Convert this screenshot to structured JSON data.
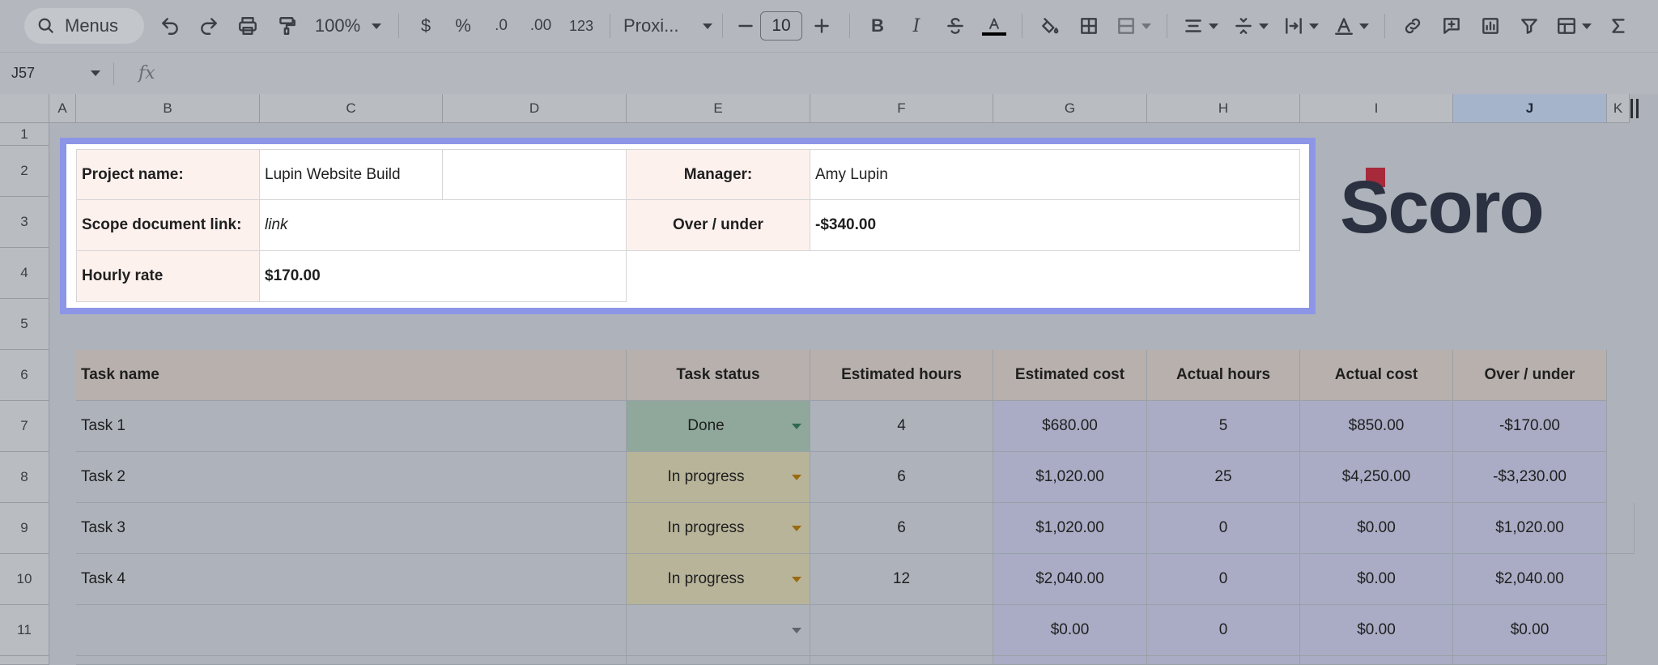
{
  "toolbar": {
    "menus_label": "Menus",
    "zoom": "100%",
    "currency": "$",
    "percent": "%",
    "dec_less": ".0",
    "dec_more": ".00",
    "number_format": "123",
    "font": "Proxi...",
    "font_size": "10",
    "bold": "B",
    "italic": "I"
  },
  "formula_bar": {
    "cell_ref": "J57",
    "fx": "fx"
  },
  "columns": [
    "A",
    "B",
    "C",
    "D",
    "E",
    "F",
    "G",
    "H",
    "I",
    "J",
    "K"
  ],
  "rows": [
    "1",
    "2",
    "3",
    "4",
    "5",
    "6",
    "7",
    "8",
    "9",
    "10",
    "11"
  ],
  "summary": {
    "project_label": "Project name:",
    "project_value": "Lupin Website Build",
    "manager_label": "Manager:",
    "manager_value": "Amy Lupin",
    "scope_label": "Scope document link:",
    "scope_value": "link",
    "over_label": "Over / under",
    "over_value": "-$340.00",
    "rate_label": "Hourly rate",
    "rate_value": "$170.00"
  },
  "table": {
    "headers": [
      "Task name",
      "Task status",
      "Estimated hours",
      "Estimated cost",
      "Actual hours",
      "Actual cost",
      "Over / under"
    ],
    "rows": [
      {
        "name": "Task 1",
        "status": "Done",
        "est_hours": "4",
        "est_cost": "$680.00",
        "act_hours": "5",
        "act_cost": "$850.00",
        "over": "-$170.00"
      },
      {
        "name": "Task 2",
        "status": "In progress",
        "est_hours": "6",
        "est_cost": "$1,020.00",
        "act_hours": "25",
        "act_cost": "$4,250.00",
        "over": "-$3,230.00"
      },
      {
        "name": "Task 3",
        "status": "In progress",
        "est_hours": "6",
        "est_cost": "$1,020.00",
        "act_hours": "0",
        "act_cost": "$0.00",
        "over": "$1,020.00"
      },
      {
        "name": "Task 4",
        "status": "In progress",
        "est_hours": "12",
        "est_cost": "$2,040.00",
        "act_hours": "0",
        "act_cost": "$0.00",
        "over": "$2,040.00"
      },
      {
        "name": "",
        "status": "",
        "est_hours": "",
        "est_cost": "$0.00",
        "act_hours": "0",
        "act_cost": "$0.00",
        "over": "$0.00"
      }
    ]
  },
  "logo_text": "Scoro",
  "colors": {
    "done": "#8fa89b",
    "in_progress": "#b7b49a",
    "header_row": "#b7b0ad",
    "cost_cells": "#a9acc4",
    "highlight_border": "#8d95e6"
  }
}
